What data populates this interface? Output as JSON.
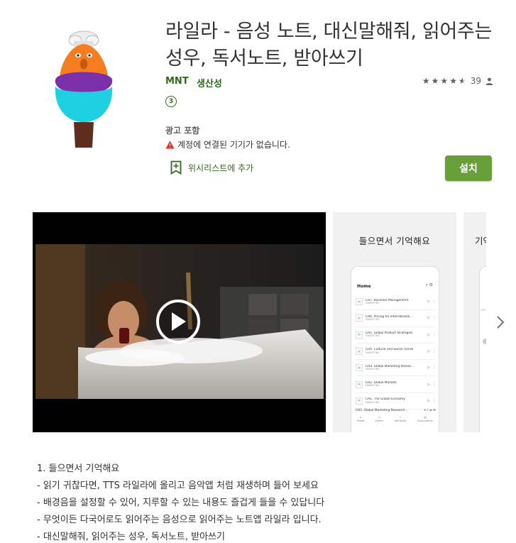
{
  "app": {
    "title": "라일라 - 음성 노트, 대신말해줘, 읽어주는 성우, 독서노트, 받아쓰기",
    "developer": "MNT",
    "category": "생산성",
    "rating_count": "39",
    "rating_stars": 4.5,
    "content_rating": "3",
    "ads_label": "광고 포함",
    "device_warning": "계정에 연결된 기기가 없습니다.",
    "wishlist_label": "위시리스트에 추가",
    "install_label": "설치",
    "accent_color": "#689f38",
    "link_color": "#33691e"
  },
  "media": {
    "screenshot1_caption": "들으면서 기억해요",
    "screenshot2_caption": "기억",
    "phone": {
      "header": "Home",
      "items": [
        {
          "title": "CH7. Business Management",
          "sub": "MARKETING"
        },
        {
          "title": "CH6. Pricing for International...",
          "sub": "MARKETING"
        },
        {
          "title": "CH5. Global Product Strategies",
          "sub": "MARKETING"
        },
        {
          "title": "CH4. Cultural and Social Forces",
          "sub": "MARKETING"
        },
        {
          "title": "CH3. Global Marketing Resear...",
          "sub": "MARKETING"
        },
        {
          "title": "CH2. Global Markets",
          "sub": "MARKETING"
        },
        {
          "title": "CH1. The Global Economy",
          "sub": "MARKETING"
        }
      ],
      "player_text": "CH3. Global Marketing Research...",
      "nav": [
        "Home",
        "Folder",
        "Add Note",
        "Subscription"
      ]
    }
  },
  "description": {
    "lines": [
      "1. 들으면서 기억해요",
      "- 읽기 귀찮다면, TTS 라일라에 올리고 음악앱 처럼 재생하며 들어 보세요",
      "- 배경음을 설정할 수 있어, 지루할 수 있는 내용도 즐겁게 들을 수 있답니다",
      "- 무엇이든 다국어로도 읽어주는 음성으로 읽어주는 노트앱 라일라 입니다.",
      "- 대신말해줘, 읽어주는 성우, 독서노트, 받아쓰기"
    ]
  }
}
